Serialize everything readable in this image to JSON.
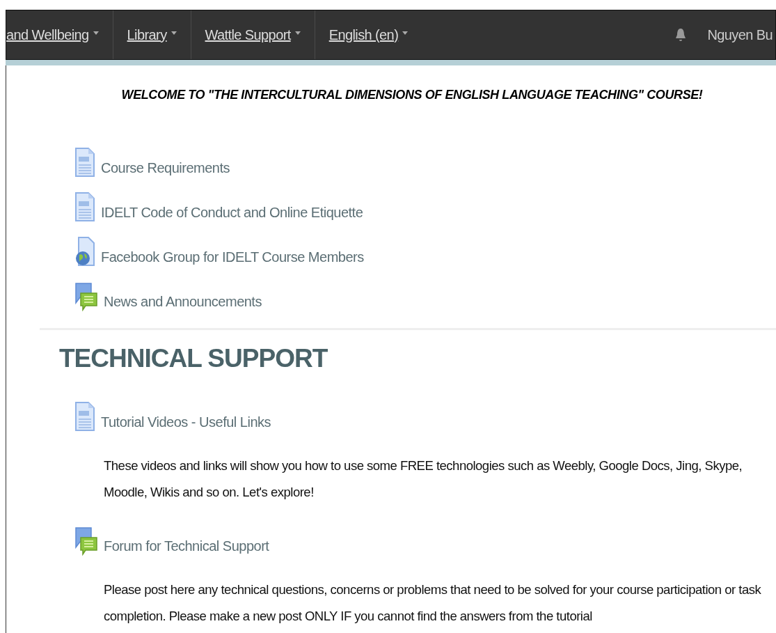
{
  "navbar": {
    "menus": [
      {
        "label": "and Wellbeing"
      },
      {
        "label": "Library"
      },
      {
        "label": "Wattle Support"
      },
      {
        "label": "English (en)"
      }
    ],
    "user": "Nguyen Bu"
  },
  "welcome": "WELCOME TO \"THE INTERCULTURAL DIMENSIONS OF ENGLISH LANGUAGE TEACHING\" COURSE!",
  "intro_items": [
    {
      "kind": "page",
      "label": "Course Requirements"
    },
    {
      "kind": "page",
      "label": "IDELT Code of Conduct and Online Etiquette"
    },
    {
      "kind": "url",
      "label": "Facebook Group for IDELT Course Members"
    },
    {
      "kind": "forum",
      "label": "News and Announcements"
    }
  ],
  "section": {
    "title": "TECHNICAL SUPPORT",
    "items": [
      {
        "kind": "page",
        "label": "Tutorial Videos - Useful Links",
        "description": "These videos and links will show you how to use some FREE technologies such as Weebly, Google Docs, Jing, Skype, Moodle, Wikis and so on. Let's explore!"
      },
      {
        "kind": "forum",
        "label": "Forum for Technical Support",
        "description": "Please post here any technical questions, concerns or problems that need to be solved for your course participation or task completion. Please make a new post ONLY IF you cannot find the answers from the tutorial"
      }
    ]
  }
}
